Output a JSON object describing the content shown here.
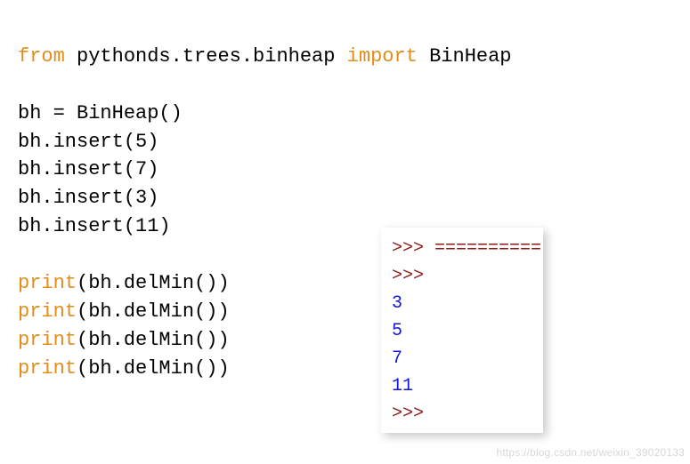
{
  "code": {
    "kw_from": "from",
    "import_path": " pythonds.trees.binheap ",
    "kw_import": "import",
    "class_name": " BinHeap",
    "blank": "",
    "l_assign": "bh = BinHeap()",
    "l_ins5": "bh.insert(5)",
    "l_ins7": "bh.insert(7)",
    "l_ins3": "bh.insert(3)",
    "l_ins11": "bh.insert(11)",
    "kw_print": "print",
    "call_delmin": "(bh.delMin())"
  },
  "output": {
    "prompt": ">>> ",
    "eqline": "==========",
    "vals": [
      "3",
      "5",
      "7",
      "11"
    ]
  },
  "watermark": "https://blog.csdn.net/weixin_39020133"
}
